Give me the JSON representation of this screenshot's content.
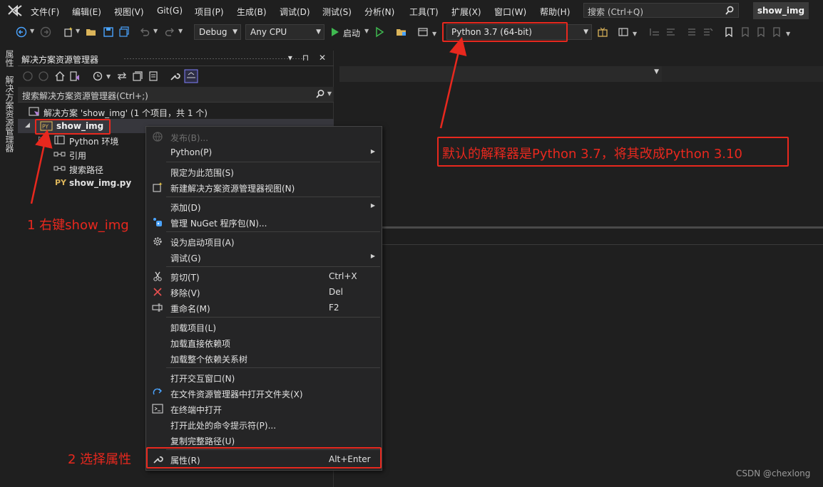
{
  "menubar": {
    "items": [
      "文件(F)",
      "编辑(E)",
      "视图(V)",
      "Git(G)",
      "项目(P)",
      "生成(B)",
      "调试(D)",
      "测试(S)",
      "分析(N)",
      "工具(T)",
      "扩展(X)",
      "窗口(W)",
      "帮助(H)"
    ],
    "search_placeholder": "搜索 (Ctrl+Q)",
    "window_title": "show_img"
  },
  "toolbar": {
    "config": "Debug",
    "platform": "Any CPU",
    "start_label": "启动",
    "interpreter": "Python 3.7 (64-bit)"
  },
  "vertical_tabs": [
    "属性",
    "解决方案资源管理器"
  ],
  "solution_explorer": {
    "title": "解决方案资源管理器",
    "search_placeholder": "搜索解决方案资源管理器(Ctrl+;)",
    "tree": [
      {
        "label": "解决方案 'show_img' (1 个项目，共 1 个)",
        "icon": "solution-icon"
      },
      {
        "label": "show_img",
        "icon": "python-project-icon",
        "selected": true
      },
      {
        "label": "Python 环境",
        "icon": "environment-icon"
      },
      {
        "label": "引用",
        "icon": "reference-icon"
      },
      {
        "label": "搜索路径",
        "icon": "search-path-icon"
      },
      {
        "label": "show_img.py",
        "icon": "python-file-icon"
      }
    ]
  },
  "context_menu": {
    "items": [
      {
        "label": "发布(B)...",
        "disabled": true,
        "icon": "publish-icon"
      },
      {
        "label": "Python(P)",
        "submenu": true
      },
      {
        "label": "限定为此范围(S)"
      },
      {
        "label": "新建解决方案资源管理器视图(N)",
        "icon": "new-view-icon"
      },
      {
        "label": "添加(D)",
        "submenu": true
      },
      {
        "label": "管理 NuGet 程序包(N)...",
        "icon": "nuget-icon"
      },
      {
        "label": "设为启动项目(A)",
        "icon": "gear-icon"
      },
      {
        "label": "调试(G)",
        "submenu": true
      },
      {
        "label": "剪切(T)",
        "shortcut": "Ctrl+X",
        "icon": "cut-icon"
      },
      {
        "label": "移除(V)",
        "shortcut": "Del",
        "icon": "remove-icon"
      },
      {
        "label": "重命名(M)",
        "shortcut": "F2",
        "icon": "rename-icon"
      },
      {
        "label": "卸载项目(L)"
      },
      {
        "label": "加载直接依赖项"
      },
      {
        "label": "加载整个依赖关系树"
      },
      {
        "label": "打开交互窗口(N)"
      },
      {
        "label": "在文件资源管理器中打开文件夹(X)",
        "icon": "open-folder-icon"
      },
      {
        "label": "在终端中打开",
        "icon": "terminal-icon"
      },
      {
        "label": "打开此处的命令提示符(P)..."
      },
      {
        "label": "复制完整路径(U)"
      },
      {
        "label": "属性(R)",
        "shortcut": "Alt+Enter",
        "icon": "wrench-icon"
      }
    ]
  },
  "annotations": {
    "step1": "1 右键show_img",
    "step2": "2 选择属性",
    "note": "默认的解释器是Python 3.7，将其改成Python 3.10"
  },
  "colors": {
    "annotation_red": "#e8281e",
    "background": "#1f1f1f",
    "menu_background": "#252526"
  },
  "watermark": "CSDN @chexlong"
}
